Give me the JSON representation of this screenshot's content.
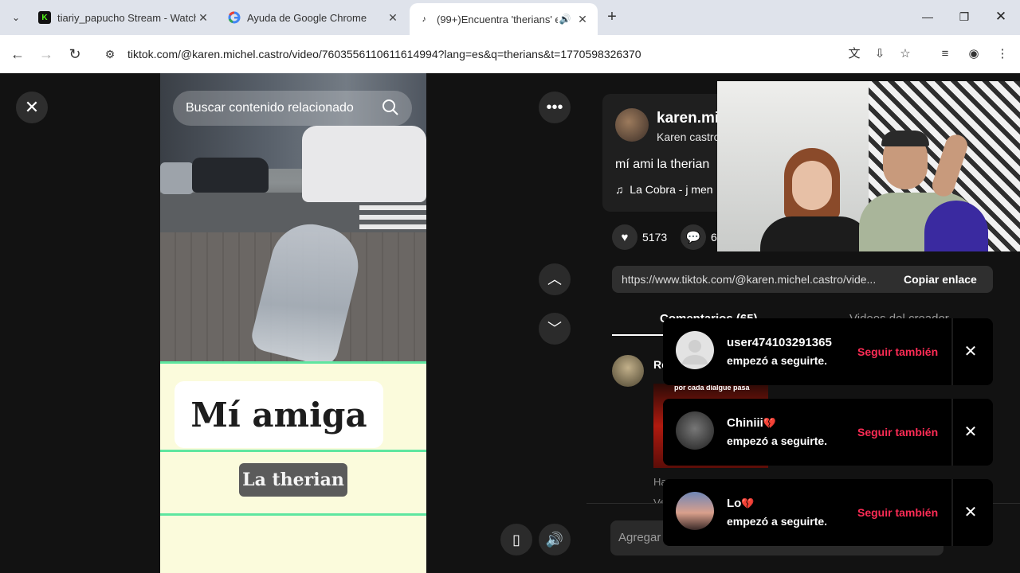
{
  "browser": {
    "tabs": [
      {
        "title": "tiariy_papucho Stream - Watch",
        "favicon": "kick-icon",
        "favicon_text": "K",
        "active": false
      },
      {
        "title": "Ayuda de Google Chrome",
        "favicon": "google-icon",
        "favicon_text": "G",
        "active": false
      },
      {
        "title": "(99+)Encuentra 'therians' en",
        "favicon": "tiktok-icon",
        "favicon_text": "♪",
        "active": true
      }
    ],
    "new_tab": "+",
    "url": "tiktok.com/@karen.michel.castro/video/7603556110611614994?lang=es&q=therians&t=1770598326370"
  },
  "video": {
    "search_placeholder": "Buscar contenido relacionado",
    "caption_main": "Mí amiga",
    "caption_sub": "La therian"
  },
  "creator": {
    "username": "karen.mi",
    "nickname": "Karen castro",
    "description": "mí ami la therian",
    "music": "La Cobra - j men",
    "likes": "5173",
    "comments": "6"
  },
  "share": {
    "link": "https://www.tiktok.com/@karen.michel.castro/vide...",
    "copy_label": "Copiar enlace"
  },
  "panel_tabs": {
    "comments": "Comentarios (65)",
    "creator_videos": "Videos del creador"
  },
  "comment": {
    "name_initial": "Ro",
    "image_text": "por cada dialgue pasa",
    "text_line1": "Ha",
    "text_line2": "Ve"
  },
  "comment_input": {
    "placeholder": "Agregar"
  },
  "notifications": [
    {
      "name": "user474103291365",
      "text": "empezó a seguirte.",
      "action": "Seguir también"
    },
    {
      "name": "Chiniii",
      "text": "empezó a seguirte.",
      "action": "Seguir también",
      "emoji": "💔"
    },
    {
      "name": "Lo",
      "text": "empezó a seguirte.",
      "action": "Seguir también",
      "emoji": "💔"
    }
  ],
  "colors": {
    "accent": "#fe2c55",
    "caption_bg": "#fbfbdc",
    "caption_line": "#5ee6a0"
  }
}
